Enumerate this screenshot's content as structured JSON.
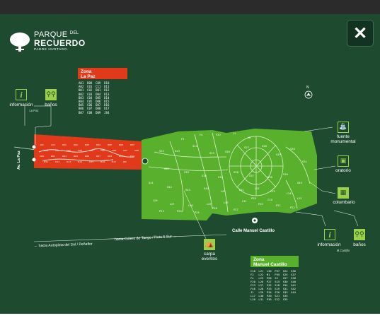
{
  "close_button": "✕",
  "logo": {
    "line1": "PARQUE",
    "line1_small": "DEL",
    "line2": "RECUERDO",
    "line3": "PADRE HURTADO."
  },
  "zona_la_paz": {
    "title_line1": "Zona",
    "title_line2": "La Paz",
    "codes": "A01  B08  C09  D10\nA02  C01  C11  D11\nB01  C02  D01  D12\nB02  C03  D04  D13\nB03  C04  D05  D14\nB04  C05  D06  D15\nB05  C06  D07  D16\nB06  C07  D08  D17\nB07  C08  D09  J84"
  },
  "zona_manuel_castillo": {
    "title_line1": "Zona",
    "title_line2": "Manuel Castillo",
    "codes": "C10  L21  L36  P37  S24  S36\nF2   L22  M1   P35  S25  S37\nF4   L23  P28  S2   S27  S38\nF20  L26  P27  S15  S30  S40\nF23  L27  P32  S18  S34  S41\nF46  L28  P33  S19  S31  S42\nJ1   L29  P34  S20  S33  S44\nL17  L30  P20  S21  S35\nL20  L31  P36  S22  S35"
  },
  "facilities_la_paz": {
    "info": "información",
    "banos": "baños",
    "sub": "La Paz"
  },
  "facilities_castillo": {
    "info": "información",
    "banos": "baños",
    "sub": "M.Castillo"
  },
  "landmarks": {
    "fuente": "fuente\nmonumental",
    "oratorio": "oratorio",
    "columbario": "columbario",
    "carpa": "carpa\neventos"
  },
  "roads": {
    "av_la_paz": "Av. La Paz",
    "autopista": "← hacia Autopista del Sol / Peñaflor",
    "colero": "hacia Colero de Tango / Ruta 5 Sur →",
    "manuel_castillo": "Calle Manuel Castillo"
  },
  "north": "N",
  "sector_labels": [
    "S22",
    "S23",
    "S24",
    "S25",
    "S26",
    "S27",
    "S28",
    "S29",
    "S30",
    "S31",
    "S32",
    "S33",
    "S34",
    "S35",
    "S36",
    "S37",
    "S38",
    "S39",
    "S40",
    "S41",
    "S42",
    "S43",
    "S44",
    "L20",
    "L21",
    "L22",
    "L23",
    "L24",
    "L25",
    "L26",
    "L27",
    "L28",
    "L29",
    "L30",
    "L31",
    "P20",
    "P21",
    "P22",
    "P23",
    "P24",
    "P25",
    "P26",
    "P27",
    "P28",
    "C10",
    "F2",
    "F4",
    "F20",
    "J1",
    "M1"
  ],
  "lapaz_labels": [
    "A01",
    "A02",
    "B01",
    "B02",
    "B03",
    "B04",
    "B05",
    "B06",
    "B07",
    "B08",
    "C01",
    "C02",
    "C03",
    "C04",
    "C05",
    "C06",
    "C07",
    "C08",
    "C09",
    "D01",
    "D04",
    "D05",
    "D06",
    "D07",
    "D08",
    "D09",
    "D10",
    "D11",
    "D12",
    "D13",
    "D14",
    "D15",
    "D16",
    "D17",
    "J84"
  ],
  "colors": {
    "background": "#1e4a30",
    "la_paz_zone": "#e03a1a",
    "castillo_zone": "#58b02c",
    "icon_green": "#9bd04a"
  }
}
